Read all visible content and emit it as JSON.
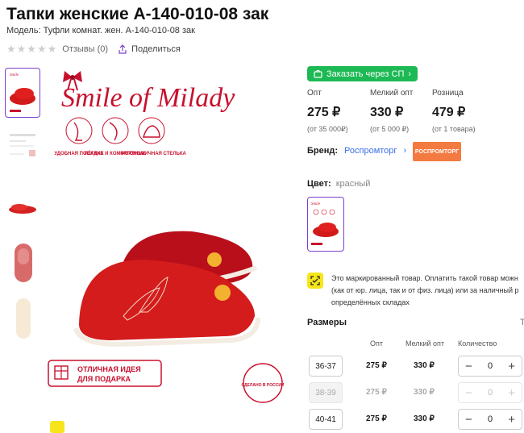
{
  "product": {
    "title": "Тапки женские А-140-010-08 зак",
    "model": "Модель: Туфли комнат. жен. А-140-010-08 зак",
    "reviews": "Отзывы (0)",
    "share": "Поделиться"
  },
  "gallery": {
    "logo_text": "Smile of Milady",
    "features": [
      "УДОБНАЯ ПОСАДКА",
      "ЛЁГКИЕ И КОМФОРТНЫЕ",
      "ЭРГОНОМИЧНАЯ СТЕЛЬКА"
    ],
    "gift_banner_line1": "ОТЛИЧНАЯ ИДЕЯ",
    "gift_banner_line2": "ДЛЯ ПОДАРКА",
    "made_in": "СДЕЛАНО В РОССИИ"
  },
  "order_sp": "Заказать через СП",
  "prices": [
    {
      "label": "Опт",
      "value": "275 ₽",
      "sub": "(от 35 000₽)"
    },
    {
      "label": "Мелкий опт",
      "value": "330 ₽",
      "sub": "(от 5 000 ₽)"
    },
    {
      "label": "Розница",
      "value": "479 ₽",
      "sub": "(от 1 товара)"
    }
  ],
  "brand": {
    "label": "Бренд:",
    "name": "Роспромторг",
    "logo_text": "РОСПРОМТОРГ"
  },
  "color": {
    "label": "Цвет:",
    "value": "красный"
  },
  "marking_text": [
    "Это маркированный товар. Оплатить такой товар можн",
    "(как от юр. лица, так и от физ. лица) или за наличный р",
    "определённых складах"
  ],
  "sizes": {
    "title": "Размеры",
    "side_link": "Т",
    "headers": {
      "opt": "Опт",
      "small_opt": "Мелкий опт",
      "qty": "Количество"
    },
    "rows": [
      {
        "size": "36-37",
        "opt": "275 ₽",
        "small_opt": "330 ₽",
        "qty": "0",
        "disabled": false
      },
      {
        "size": "38-39",
        "opt": "275 ₽",
        "small_opt": "330 ₽",
        "qty": "0",
        "disabled": true
      },
      {
        "size": "40-41",
        "opt": "275 ₽",
        "small_opt": "330 ₽",
        "qty": "0",
        "disabled": false
      }
    ],
    "minus": "−",
    "plus": "+"
  },
  "colors": {
    "accent": "#7b3fd0",
    "sp_green": "#1db954",
    "brand_red": "#c8102e",
    "link": "#3a6ee8"
  }
}
